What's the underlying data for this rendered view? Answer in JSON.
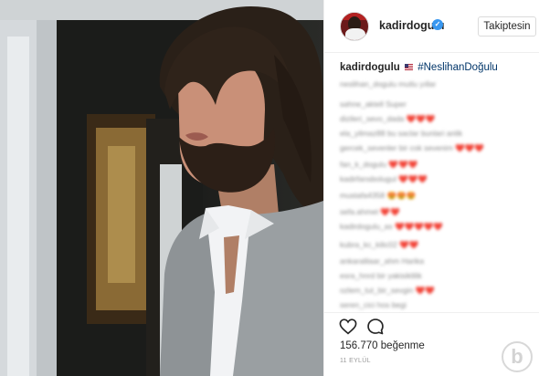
{
  "post": {
    "photo": {
      "alt": ""
    },
    "header": {
      "username": "kadirdogulu",
      "verified_icon": "verified-badge-icon",
      "follow_label": "Takiptesin"
    },
    "caption": {
      "username": "kadirdogulu",
      "flag_icon": "flag-icon",
      "hashtag": "#NeslihanDoğulu"
    },
    "comments": [
      "neslihan_dogulu mutlu yıllar",
      "sahne_aktell Super",
      "dizileri_sevo_dada ❤️❤️❤️",
      "ela_yilmaz88 bu saclar bunlari anlik",
      "gercek_sevenler bir cok sevenim ❤️❤️❤️",
      "fan_k_dogulu ❤️❤️❤️",
      "kadirfansbolugul ❤️❤️❤️",
      "mustafa4358 😍😍😍",
      "sefa.ahmet ❤️❤️",
      "kadirdogulu_as ❤️❤️❤️❤️❤️",
      "kubra_kc_kilic02 ❤️❤️",
      "ankaralilaar_ahm Harika",
      "esra_hnrd bir yakisiklilik",
      "ozlem_tut_bir_sevgin ❤️❤️",
      "seren_cici hos begi"
    ],
    "actions": {
      "like_icon": "heart-icon",
      "comment_icon": "speech-bubble-icon"
    },
    "likes": {
      "count": "156.770",
      "label": "beğenme"
    },
    "date": "11 EYLÜL",
    "watermark": "b"
  }
}
